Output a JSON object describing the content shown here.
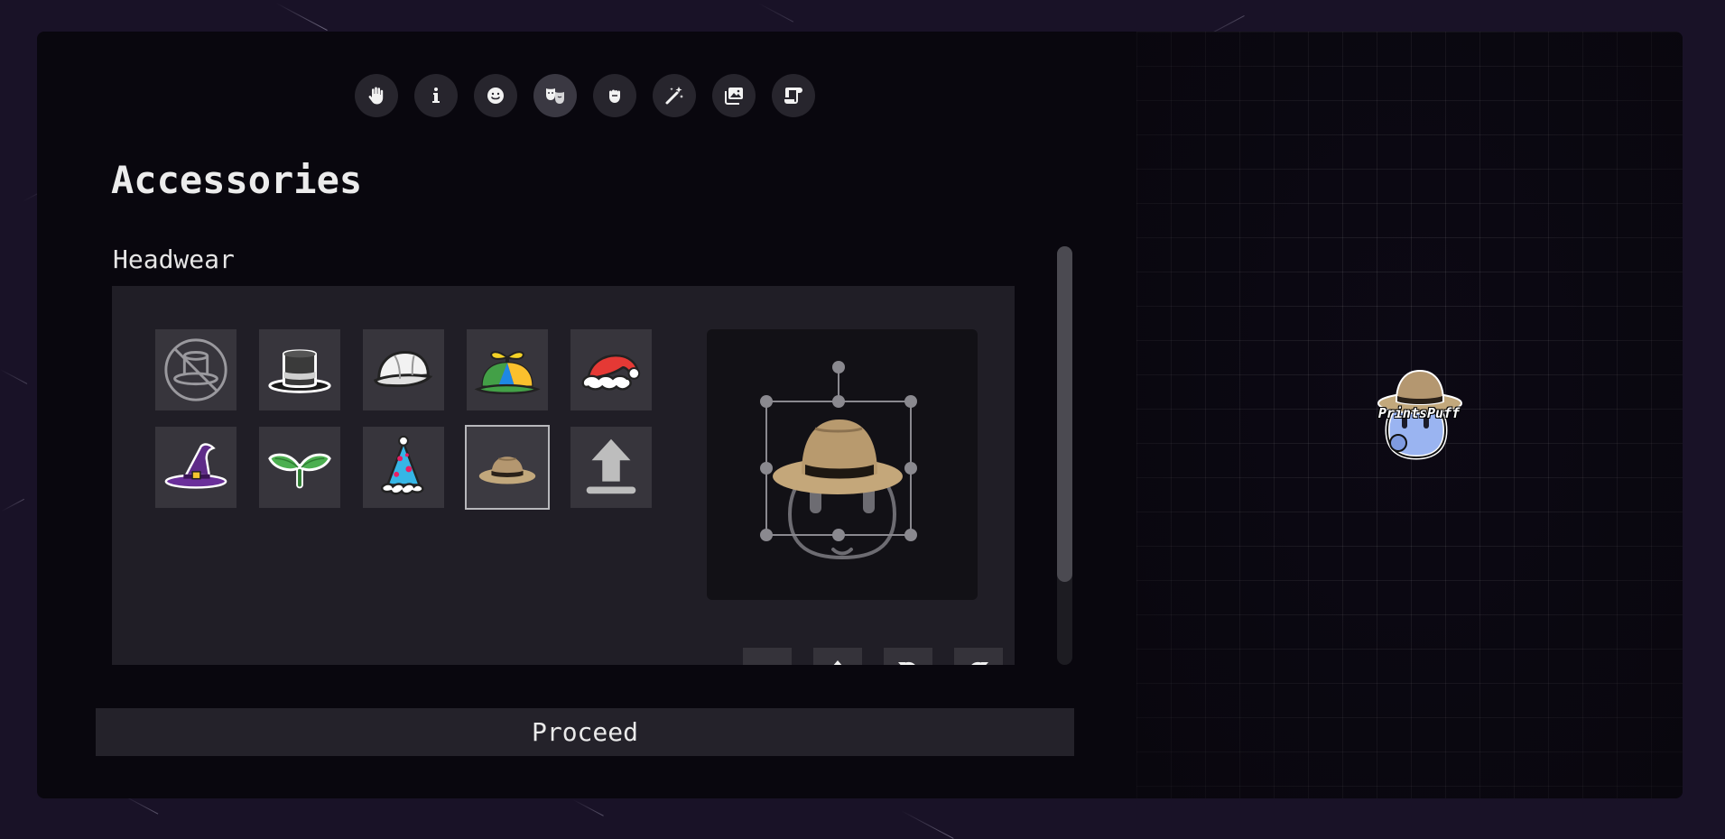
{
  "toolbar": {
    "items": [
      {
        "name": "hand-icon"
      },
      {
        "name": "info-icon"
      },
      {
        "name": "face-icon"
      },
      {
        "name": "masks-icon",
        "active": true
      },
      {
        "name": "fist-icon"
      },
      {
        "name": "magic-wand-icon"
      },
      {
        "name": "images-icon"
      },
      {
        "name": "scroll-icon"
      }
    ]
  },
  "page": {
    "title": "Accessories",
    "section": "Headwear"
  },
  "headwear": {
    "items": [
      {
        "name": "no-hat-icon"
      },
      {
        "name": "top-hat-icon"
      },
      {
        "name": "baseball-cap-icon"
      },
      {
        "name": "propeller-hat-icon"
      },
      {
        "name": "santa-hat-icon"
      },
      {
        "name": "witch-hat-icon"
      },
      {
        "name": "leaf-sprout-icon"
      },
      {
        "name": "party-hat-icon"
      },
      {
        "name": "straw-fedora-icon",
        "selected": true
      },
      {
        "name": "upload-icon"
      }
    ]
  },
  "preview_controls": [
    {
      "name": "flip-horizontal-icon"
    },
    {
      "name": "flip-vertical-icon"
    },
    {
      "name": "rotate-left-icon"
    },
    {
      "name": "rotate-right-icon"
    }
  ],
  "actions": {
    "proceed_label": "Proceed"
  },
  "character": {
    "name": "PrintsPuff",
    "body_color": "#9ab4f1"
  },
  "colors": {
    "background": "#191227",
    "panel": "#201e26",
    "tile": "#37353c"
  }
}
